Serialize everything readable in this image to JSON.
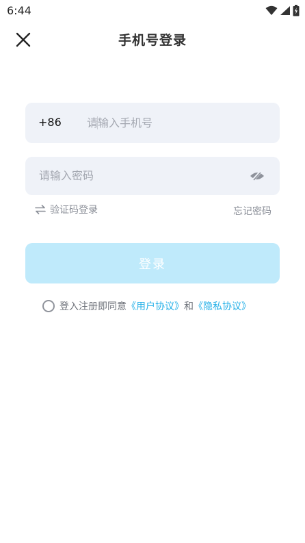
{
  "status_bar": {
    "time": "6:44",
    "icons": [
      "wifi-icon",
      "signal-icon",
      "battery-icon"
    ]
  },
  "header": {
    "title": "手机号登录",
    "close_icon": "close-icon"
  },
  "phone_field": {
    "country_code": "+86",
    "value": "",
    "placeholder": "请输入手机号"
  },
  "password_field": {
    "value": "",
    "placeholder": "请输入密码",
    "toggle_icon": "eye-slash-icon"
  },
  "helper": {
    "switch_label": "验证码登录",
    "switch_icon": "swap-arrows-icon",
    "forgot_label": "忘记密码"
  },
  "login_button": {
    "label": "登录"
  },
  "agreement": {
    "prefix": "登入注册即同意",
    "user_agreement": "《用户协议》",
    "and": "和",
    "privacy_policy": "《隐私协议》",
    "checked": false
  },
  "colors": {
    "accent": "#27b1e8",
    "button_bg": "#bfeafb",
    "field_bg": "#eff2f8",
    "hint_text": "#a3a7b0"
  }
}
